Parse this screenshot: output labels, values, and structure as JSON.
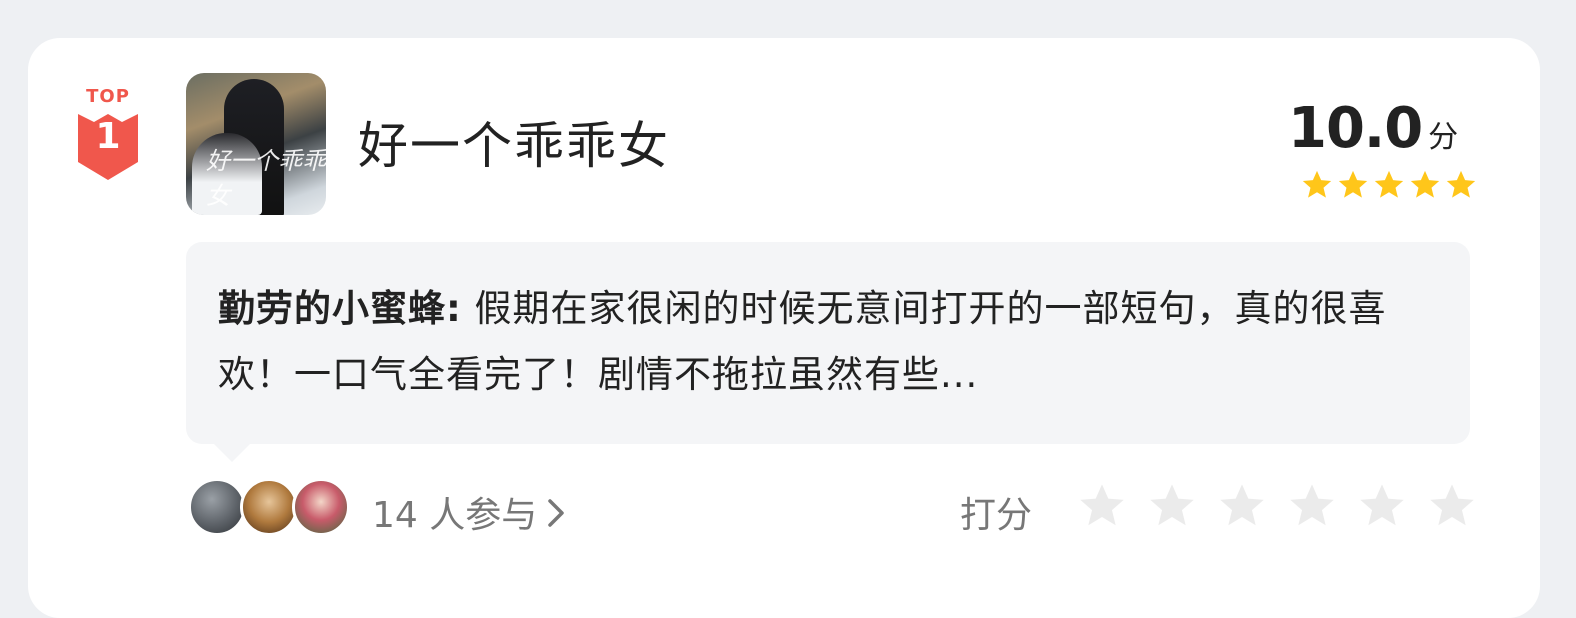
{
  "badge": {
    "top_label": "TOP",
    "rank": "1",
    "color": "#f0574c"
  },
  "show": {
    "title": "好一个乖乖女",
    "poster_caption": "好一个乖乖女"
  },
  "score": {
    "value": "10.0",
    "unit": "分",
    "stars_filled": 5,
    "stars_total": 5,
    "star_color": "#ffc61a"
  },
  "comment": {
    "author": "勤劳的小蜜蜂:",
    "text": " 假期在家很闲的时候无意间打开的一部短句，真的很喜欢！一口气全看完了！剧情不拖拉虽然有些..."
  },
  "participants": {
    "label": "14 人参与"
  },
  "rating": {
    "label": "打分",
    "stars_total": 6,
    "star_color": "#ebebeb"
  }
}
